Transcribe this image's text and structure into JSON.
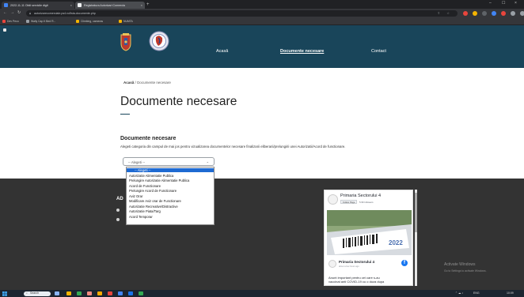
{
  "browser": {
    "tabs": [
      {
        "title": "2022-11-11 Obiii servicile digit"
      },
      {
        "title": "Registratura Autorizari Comercia"
      }
    ],
    "new_tab": "+",
    "close": "×",
    "url": "autorizarecomerciale.ps4.ro/lista-documente.php",
    "bookmarks": [
      {
        "label": "Dev Peco"
      },
      {
        "label": "Wally Cap It Bed R..."
      },
      {
        "label": "Climbing, cameras"
      },
      {
        "label": "NUMTA"
      }
    ],
    "window_controls": {
      "minimize": "–",
      "maximize": "☐",
      "close": "×"
    }
  },
  "header": {
    "nav": [
      {
        "label": "Acasă"
      },
      {
        "label": "Documente necesare"
      },
      {
        "label": "Contact"
      }
    ]
  },
  "breadcrumb": {
    "home": "Acasă",
    "separator": "/",
    "current": "Documente necesare"
  },
  "page": {
    "title": "Documente necesare",
    "section_title": "Documente necesare",
    "description": "Alegeti categoria din campul de mai jos pentru vizualizarea documentelor necesare finalizarii eliberarii/prelungirii unei Autorizatii/Acord de functionare."
  },
  "select": {
    "value": "-- Alegeti --",
    "options": [
      "-- Alegeti --",
      "Autorizatie Alimentatie Publica",
      "Prelungire Autorizatie Alimentatie Publica",
      "Acord de Functionare",
      "Prelungire Acord de Functionare",
      "Aviz Orar",
      "Modificare Aviz orar de Functionare",
      "Autorizatie Recreative/Distractive",
      "Autorizatie Piata/Targ",
      "Acord Temporar"
    ],
    "selected_index": 0
  },
  "footer": {
    "heading_partial": "AD"
  },
  "facebook": {
    "page_name": "Primaria Sectorului 4",
    "follow_label": "Follow Page",
    "followers": "5.9K followers",
    "post_author": "Primaria Sectorului 4",
    "post_meta": "about a few hours ago",
    "post_text_line1": "Anunt important pentru cei care s-au",
    "post_text_line2": "vaccinat anti COVID-19 cu o doza dupa",
    "photo_year": "2022"
  },
  "windows_notice": {
    "title": "Activate Windows",
    "subtitle": "Go to Settings to activate Windows."
  },
  "taskbar": {
    "search_placeholder": "Search",
    "language": "ENG",
    "clock": "10:09"
  },
  "colors": {
    "header_bg": "#19455a",
    "footer_bg": "#333333",
    "select_highlight": "#1e6ad2",
    "facebook_blue": "#1877f2"
  }
}
